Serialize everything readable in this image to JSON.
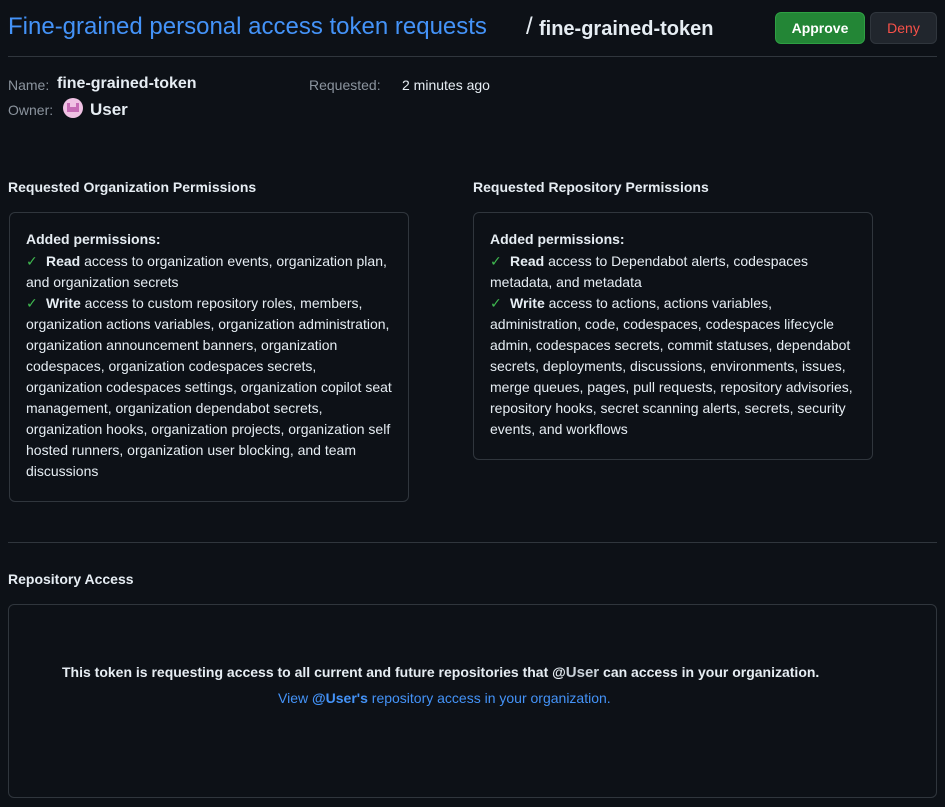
{
  "header": {
    "breadcrumb_link": "Fine-grained personal access token requests",
    "separator": "/",
    "current": "fine-grained-token",
    "approve_label": "Approve",
    "deny_label": "Deny"
  },
  "meta": {
    "name_label": "Name:",
    "name_value": "fine-grained-token",
    "owner_label": "Owner:",
    "owner_value": "User",
    "requested_label": "Requested:",
    "requested_value": "2 minutes ago"
  },
  "org_permissions": {
    "title": "Requested Organization Permissions",
    "box_title": "Added permissions:",
    "read_word": "Read",
    "read_text": " access to organization events, organization plan, and organization secrets",
    "write_word": "Write",
    "write_text": " access to custom repository roles, members, organization actions variables, organization administration, organization announcement banners, organization codespaces, organization codespaces secrets, organization codespaces settings, organization copilot seat management, organization dependabot secrets, organization hooks, organization projects, organization self hosted runners, organization user blocking, and team discussions"
  },
  "repo_permissions": {
    "title": "Requested Repository Permissions",
    "box_title": "Added permissions:",
    "read_word": "Read",
    "read_text": " access to Dependabot alerts, codespaces metadata, and metadata",
    "write_word": "Write",
    "write_text": " access to actions, actions variables, administration, code, codespaces, codespaces lifecycle admin, codespaces secrets, commit statuses, dependabot secrets, deployments, discussions, environments, issues, merge queues, pages, pull requests, repository advisories, repository hooks, secret scanning alerts, secrets, security events, and workflows"
  },
  "repo_access": {
    "title": "Repository Access",
    "line_prefix": "This token is requesting access to all current and future repositories that @",
    "line_user": "User",
    "line_suffix": " can access in your organization.",
    "link_prefix": "View ",
    "link_user": "@User's",
    "link_suffix": " repository access in your organization."
  },
  "icons": {
    "check": "check-icon",
    "avatar": "user-avatar"
  },
  "colors": {
    "accent": "#4493f8",
    "approve": "#238636",
    "deny_text": "#f85149",
    "check": "#3fb950"
  }
}
